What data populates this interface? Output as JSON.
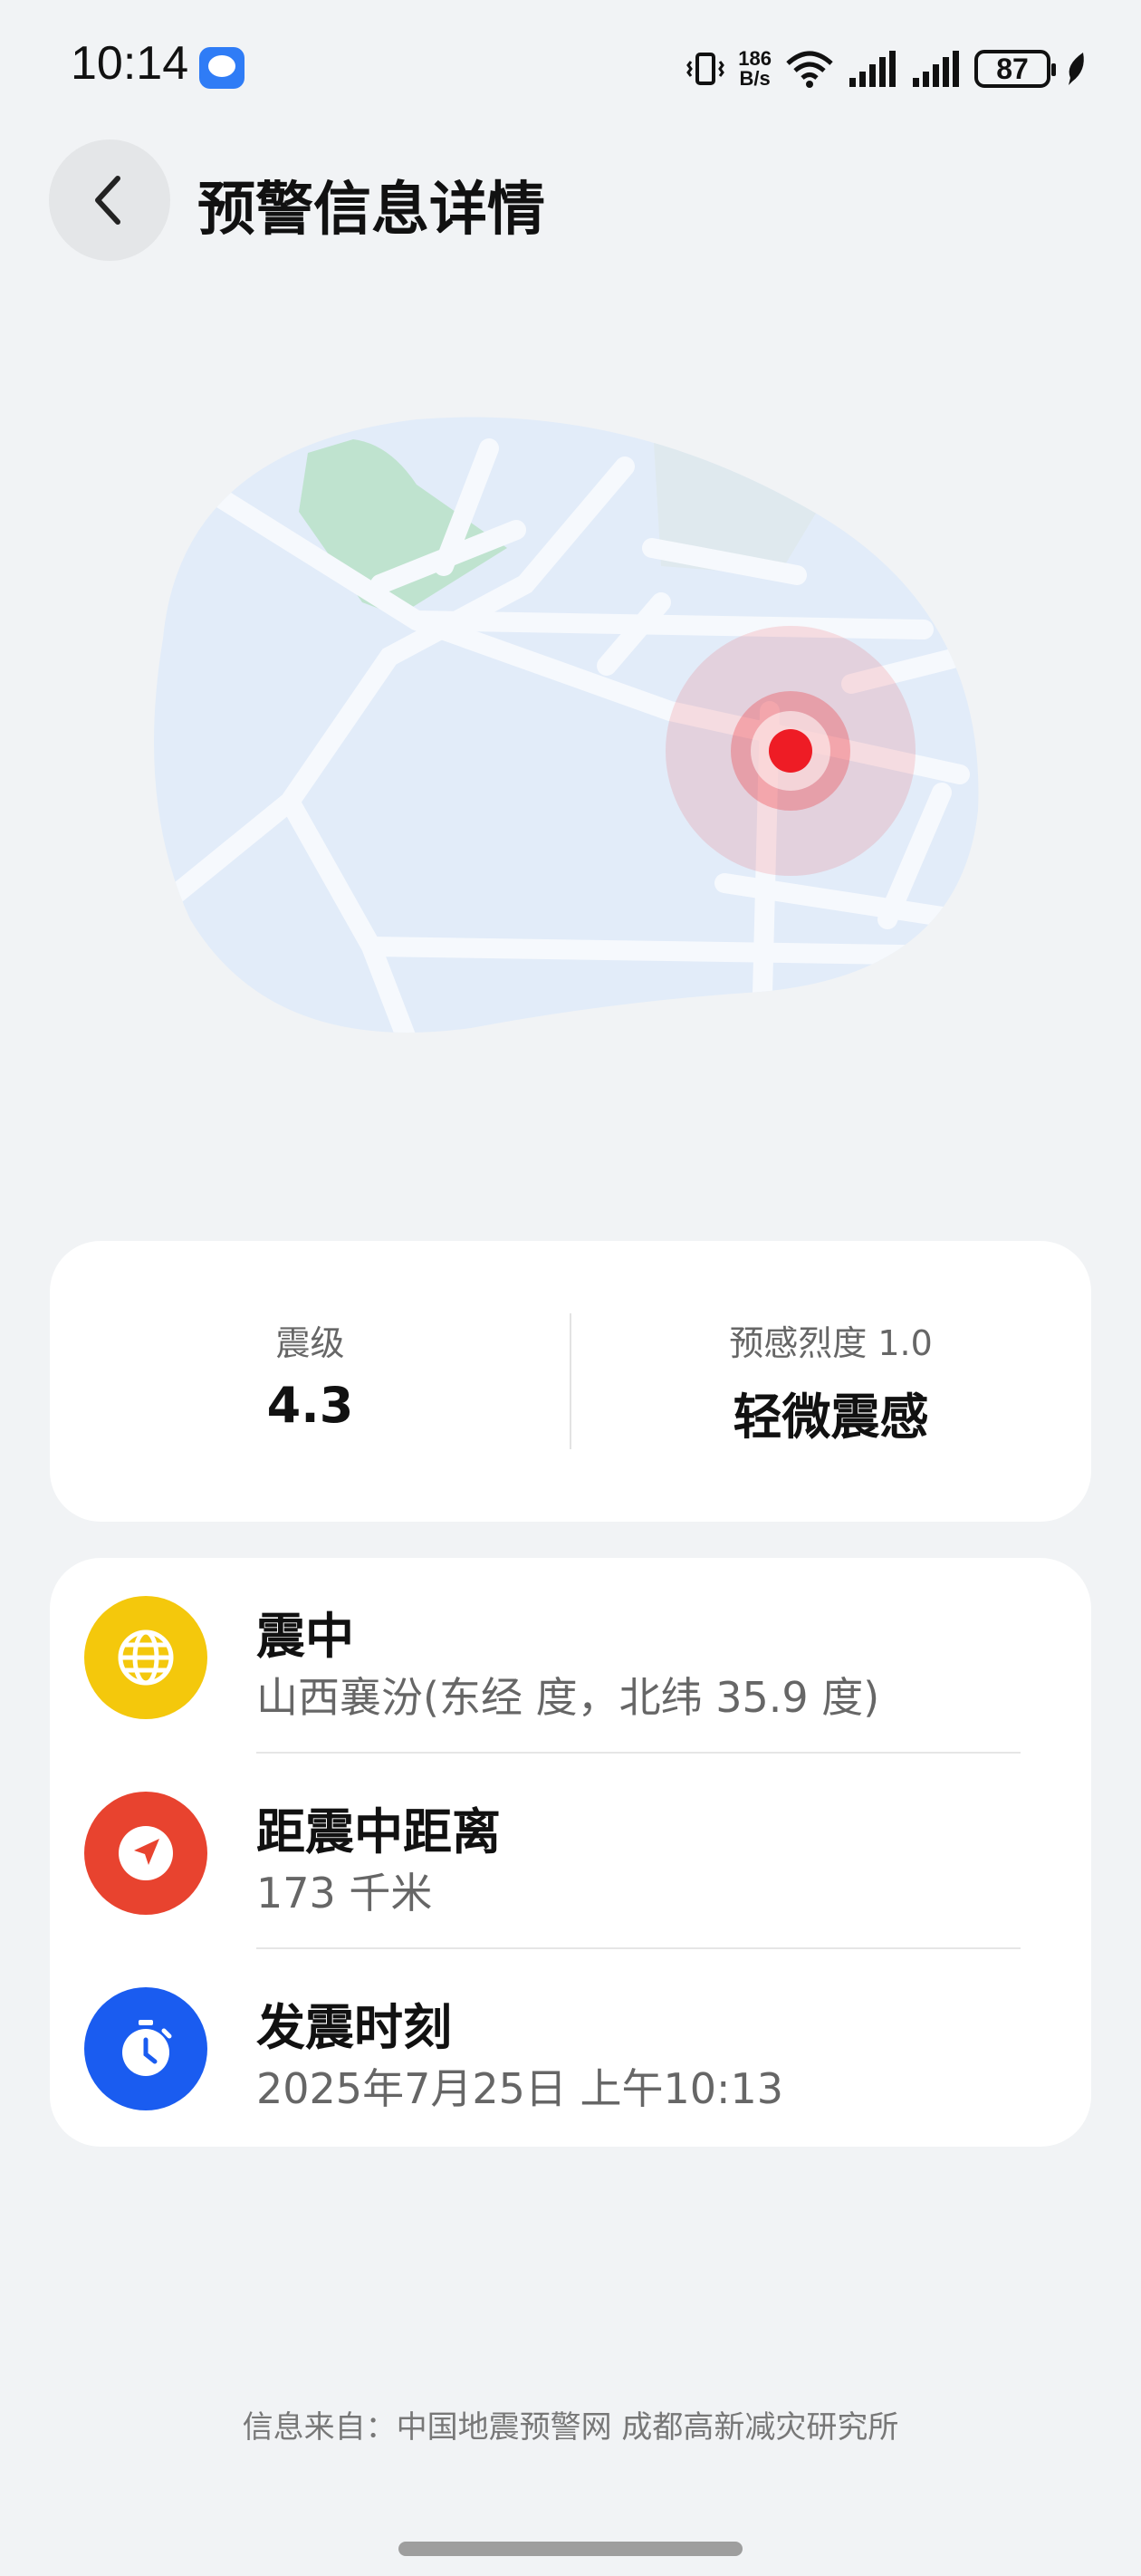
{
  "status_bar": {
    "time": "10:14",
    "net_speed_value": "186",
    "net_speed_unit": "B/s",
    "battery": "87"
  },
  "header": {
    "title": "预警信息详情"
  },
  "magnitude": {
    "label": "震级",
    "value": "4.3",
    "intensity_label": "预感烈度 1.0",
    "intensity_value": "轻微震感"
  },
  "info": [
    {
      "title": "震中",
      "value": "山西襄汾(东经 度，北纬 35.9 度)",
      "icon": "globe-icon",
      "color": "#f4c80c"
    },
    {
      "title": "距震中距离",
      "value": "173 千米",
      "icon": "navigation-arrow-icon",
      "color": "#e8432f"
    },
    {
      "title": "发震时刻",
      "value": "2025年7月25日 上午10:13",
      "icon": "stopwatch-icon",
      "color": "#1a5cf0"
    }
  ],
  "footer": {
    "source": "信息来自：中国地震预警网 成都高新减灾研究所"
  },
  "colors": {
    "background": "#f1f3f5",
    "epicenter": "#ee1c25",
    "map_land": "#e2ecf9",
    "map_park": "#bfe3cf"
  }
}
